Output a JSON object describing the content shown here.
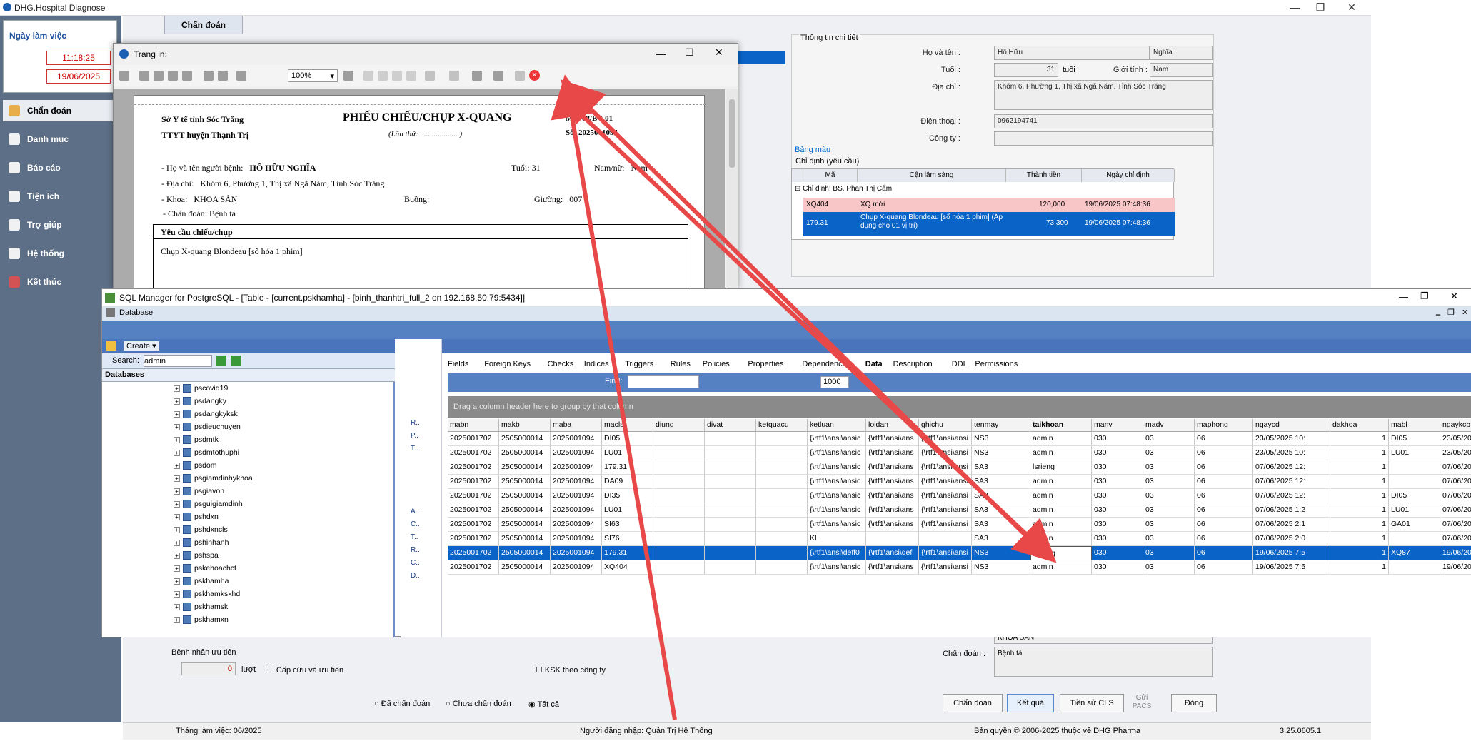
{
  "app": {
    "title": "DHG.Hospital Diagnose",
    "work_date_label": "Ngày làm việc",
    "time": "11:18:25",
    "date": "19/06/2025",
    "tab": "Chẩn đoán",
    "nav": [
      "Chẩn đoán",
      "Danh mục",
      "Báo cáo",
      "Tiện ích",
      "Trợ giúp",
      "Hệ thống",
      "Kết thúc"
    ]
  },
  "info": {
    "section_title": "Thông tin chi tiết",
    "hoten_label": "Họ và tên :",
    "hoten_value": "Hồ Hữu",
    "ten_value": "Nghĩa",
    "tuoi_label": "Tuổi :",
    "tuoi_value": "31",
    "tuoi_unit": "tuổi",
    "gioitinh_label": "Giới tính :",
    "gioitinh_value": "Nam",
    "diachi_label": "Địa chỉ :",
    "diachi_value": "Khóm 6, Phường 1, Thị xã Ngã Năm, Tỉnh Sóc Trăng",
    "dienthoai_label": "Điện thoại :",
    "dienthoai_value": "0962194741",
    "congty_label": "Công ty :",
    "bangmau": "Bảng màu",
    "chidinh_title": "Chỉ định (yêu cầu)",
    "grid_headers": [
      "Mã",
      "Cận lâm sàng",
      "Thành tiền",
      "Ngày chỉ định"
    ],
    "group_row": "Chỉ định:  BS. Phan Thị Cẩm",
    "rows": [
      {
        "ma": "XQ404",
        "cls": "XQ mới",
        "tien": "120,000",
        "ngay": "19/06/2025 07:48:36"
      },
      {
        "ma": "179.31",
        "cls": "Chụp X-quang Blondeau [số hóa 1 phim] (Áp dụng cho 01 vị trí)",
        "tien": "73,300",
        "ngay": "19/06/2025 07:48:36"
      }
    ]
  },
  "bottom": {
    "noigui_value": "KHOA SẢN",
    "chandoan_label": "Chẩn đoán :",
    "chandoan_value": "Bệnh tả",
    "benhnhan_uutien": "Bệnh nhân ưu tiên",
    "count": "0",
    "count_unit": "lượt",
    "capcuu": "Cấp cứu và ưu tiên",
    "ksk": "KSK theo công ty",
    "radio_da": "Đã chẩn đoán",
    "radio_chua": "Chưa chẩn đoán",
    "radio_tatca": "Tất cả",
    "btn_chandoan": "Chẩn đoán",
    "btn_ketqua": "Kết quả",
    "btn_tiensu": "Tiền sử CLS",
    "btn_gui": "Gửi PACS",
    "btn_dong": "Đóng"
  },
  "status": {
    "thang": "Tháng làm việc: 06/2025",
    "user": "Người đăng nhập: Quản Trị Hệ Thống",
    "copyright": "Bản quyền © 2006-2025 thuộc về DHG Pharma",
    "version": "3.25.0605.1"
  },
  "print": {
    "title": "Trang in:",
    "zoom": "100%",
    "org1": "Sở Y tế tỉnh Sóc Trăng",
    "org2": "TTYT huyện Thạnh Trị",
    "doc_title": "PHIẾU CHIẾU/CHỤP X-QUANG",
    "lanthu": "(Lần thứ: ....................)",
    "ms": "MS: 08/BV-01",
    "so": "Số: 2025001094",
    "hoten_lbl": "- Họ và tên người bệnh:",
    "hoten": "HỒ HỮU NGHĨA",
    "tuoi_lbl": "Tuổi: 31",
    "namnu_lbl": "Nam/nữ:",
    "namnu": "Nam",
    "diachi_lbl": "- Địa chỉ:",
    "diachi": "Khóm 6, Phường 1, Thị xã Ngã Năm, Tỉnh Sóc Trăng",
    "khoa_lbl": "- Khoa:",
    "khoa": "KHOA SẢN",
    "buong_lbl": "Buồng:",
    "giuong_lbl": "Giường:",
    "giuong": "007",
    "chandoan": "- Chẩn đoán: Bệnh tả",
    "yeucau": "Yêu cầu chiếu/chụp",
    "yeucau_value": "Chụp X-quang Blondeau [số hóa 1 phim]"
  },
  "sql": {
    "title": "SQL Manager for PostgreSQL - [Table - [current.pskhamha] - [binh_thanhtri_full_2 on 192.168.50.79:5434]]",
    "menu": "Database",
    "create": "Create",
    "search_label": "Search:",
    "search_value": "admin",
    "databases": "Databases",
    "tree": [
      "pscovid19",
      "psdangky",
      "psdangkyksk",
      "psdieuchuyen",
      "psdmtk",
      "psdmtothuphi",
      "psdom",
      "psgiamdinhykhoa",
      "psgiavon",
      "psguigiamdinh",
      "pshdxn",
      "pshdxncls",
      "pshinhanh",
      "pshspa",
      "pskehoachct",
      "pskhamha",
      "pskhamkskhd",
      "pskhamsk",
      "pskhamxn"
    ],
    "tabs": [
      "Fields",
      "Foreign Keys",
      "Checks",
      "Indices",
      "Triggers",
      "Rules",
      "Policies",
      "Properties",
      "Dependencies",
      "Data",
      "Description",
      "DDL",
      "Permissions"
    ],
    "find_label": "Find:",
    "limit": "1000",
    "groupbar": "Drag a column header here to group by that column",
    "columns": [
      "mabn",
      "makb",
      "maba",
      "macls",
      "diung",
      "divat",
      "ketquacu",
      "ketluan",
      "loidan",
      "ghichu",
      "tenmay",
      "taikhoan",
      "manv",
      "madv",
      "maphong",
      "ngaycd",
      "dakhoa",
      "mabl",
      "ngaykcb"
    ],
    "rows": [
      [
        "2025001702",
        "2505000014",
        "2025001094",
        "DI05",
        "",
        "",
        "",
        "{\\rtf1\\ansi\\ansic",
        "{\\rtf1\\ansi\\ans",
        "{\\rtf1\\ansi\\ansi",
        "NS3",
        "admin",
        "030",
        "03",
        "06",
        "23/05/2025 10:",
        "1",
        "DI05",
        "23/05/20"
      ],
      [
        "2025001702",
        "2505000014",
        "2025001094",
        "LU01",
        "",
        "",
        "",
        "{\\rtf1\\ansi\\ansic",
        "{\\rtf1\\ansi\\ans",
        "{\\rtf1\\ansi\\ansi",
        "NS3",
        "admin",
        "030",
        "03",
        "06",
        "23/05/2025 10:",
        "1",
        "LU01",
        "23/05/20"
      ],
      [
        "2025001702",
        "2505000014",
        "2025001094",
        "179.31",
        "",
        "",
        "",
        "{\\rtf1\\ansi\\ansic",
        "{\\rtf1\\ansi\\ans",
        "{\\rtf1\\ansi\\ansi",
        "SA3",
        "lsrieng",
        "030",
        "03",
        "06",
        "07/06/2025 12:",
        "1",
        "",
        "07/06/20"
      ],
      [
        "2025001702",
        "2505000014",
        "2025001094",
        "DA09",
        "",
        "",
        "",
        "{\\rtf1\\ansi\\ansic",
        "{\\rtf1\\ansi\\ans",
        "{\\rtf1\\ansi\\ansi",
        "SA3",
        "admin",
        "030",
        "03",
        "06",
        "07/06/2025 12:",
        "1",
        "",
        "07/06/20"
      ],
      [
        "2025001702",
        "2505000014",
        "2025001094",
        "DI35",
        "",
        "",
        "",
        "{\\rtf1\\ansi\\ansic",
        "{\\rtf1\\ansi\\ans",
        "{\\rtf1\\ansi\\ansi",
        "SA3",
        "admin",
        "030",
        "03",
        "06",
        "07/06/2025 12:",
        "1",
        "DI05",
        "07/06/20"
      ],
      [
        "2025001702",
        "2505000014",
        "2025001094",
        "LU01",
        "",
        "",
        "",
        "{\\rtf1\\ansi\\ansic",
        "{\\rtf1\\ansi\\ans",
        "{\\rtf1\\ansi\\ansi",
        "SA3",
        "admin",
        "030",
        "03",
        "06",
        "07/06/2025 1:2",
        "1",
        "LU01",
        "07/06/20"
      ],
      [
        "2025001702",
        "2505000014",
        "2025001094",
        "SI63",
        "",
        "",
        "",
        "{\\rtf1\\ansi\\ansic",
        "{\\rtf1\\ansi\\ans",
        "{\\rtf1\\ansi\\ansi",
        "SA3",
        "admin",
        "030",
        "03",
        "06",
        "07/06/2025 2:1",
        "1",
        "GA01",
        "07/06/20"
      ],
      [
        "2025001702",
        "2505000014",
        "2025001094",
        "SI76",
        "",
        "",
        "",
        "KL",
        "",
        "",
        "SA3",
        "admin",
        "030",
        "03",
        "06",
        "07/06/2025 2:0",
        "1",
        "",
        "07/06/20"
      ],
      [
        "2025001702",
        "2505000014",
        "2025001094",
        "179.31",
        "",
        "",
        "",
        "{\\rtf1\\ansi\\deff0",
        "{\\rtf1\\ansi\\def",
        "{\\rtf1\\ansi\\ansi",
        "NS3",
        "lsrieng",
        "030",
        "03",
        "06",
        "19/06/2025 7:5",
        "1",
        "XQ87",
        "19/06/20"
      ],
      [
        "2025001702",
        "2505000014",
        "2025001094",
        "XQ404",
        "",
        "",
        "",
        "{\\rtf1\\ansi\\ansic",
        "{\\rtf1\\ansi\\ans",
        "{\\rtf1\\ansi\\ansi",
        "NS3",
        "admin",
        "030",
        "03",
        "06",
        "19/06/2025 7:5",
        "1",
        "",
        "19/06/20"
      ]
    ],
    "side_items": [
      "R..",
      "P..",
      "T..",
      "A..",
      "C..",
      "T..",
      "R..",
      "C..",
      "D.."
    ]
  }
}
